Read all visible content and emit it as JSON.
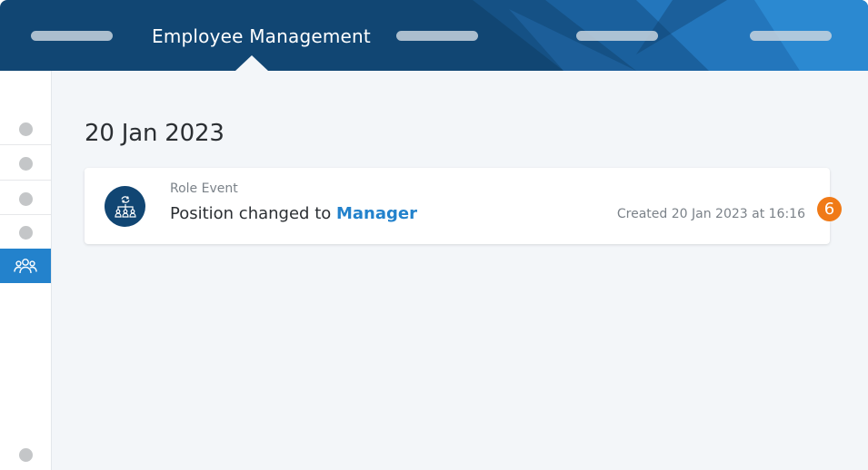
{
  "header": {
    "title": "Employee Management",
    "nav_placeholders": [
      "",
      "",
      "",
      ""
    ],
    "colors": {
      "background": "#114673",
      "accent": "#2382cc"
    }
  },
  "sidebar": {
    "items": [
      {
        "name": "sidebar-item-1",
        "icon": "dot-icon",
        "active": false
      },
      {
        "name": "sidebar-item-2",
        "icon": "dot-icon",
        "active": false
      },
      {
        "name": "sidebar-item-3",
        "icon": "dot-icon",
        "active": false
      },
      {
        "name": "sidebar-item-4",
        "icon": "dot-icon",
        "active": false
      },
      {
        "name": "sidebar-item-people",
        "icon": "people-icon",
        "active": true
      },
      {
        "name": "sidebar-item-bottom",
        "icon": "dot-icon",
        "active": false
      }
    ]
  },
  "main": {
    "date_heading": "20 Jan 2023",
    "events": [
      {
        "type": "Role Event",
        "icon": "role-hierarchy-icon",
        "text_prefix": "Position changed to ",
        "text_highlight": "Manager",
        "created": "Created 20 Jan 2023 at 16:16",
        "badge": "6"
      }
    ]
  }
}
